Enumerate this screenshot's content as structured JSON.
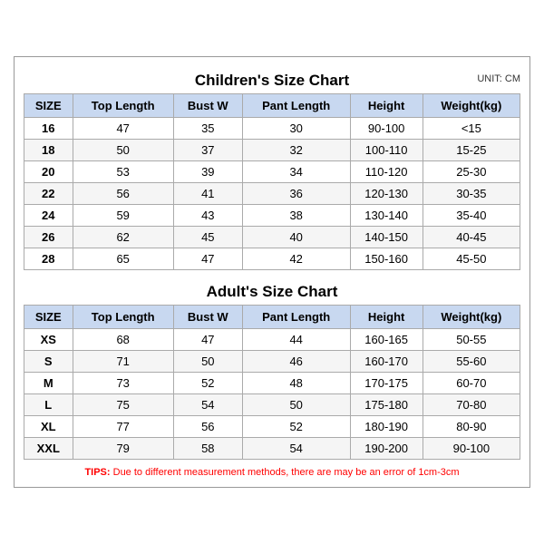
{
  "children": {
    "title": "Children's Size Chart",
    "unit": "UNIT: CM",
    "headers": [
      "SIZE",
      "Top Length",
      "Bust W",
      "Pant Length",
      "Height",
      "Weight(kg)"
    ],
    "rows": [
      [
        "16",
        "47",
        "35",
        "30",
        "90-100",
        "<15"
      ],
      [
        "18",
        "50",
        "37",
        "32",
        "100-110",
        "15-25"
      ],
      [
        "20",
        "53",
        "39",
        "34",
        "110-120",
        "25-30"
      ],
      [
        "22",
        "56",
        "41",
        "36",
        "120-130",
        "30-35"
      ],
      [
        "24",
        "59",
        "43",
        "38",
        "130-140",
        "35-40"
      ],
      [
        "26",
        "62",
        "45",
        "40",
        "140-150",
        "40-45"
      ],
      [
        "28",
        "65",
        "47",
        "42",
        "150-160",
        "45-50"
      ]
    ]
  },
  "adults": {
    "title": "Adult's Size Chart",
    "headers": [
      "SIZE",
      "Top Length",
      "Bust W",
      "Pant Length",
      "Height",
      "Weight(kg)"
    ],
    "rows": [
      [
        "XS",
        "68",
        "47",
        "44",
        "160-165",
        "50-55"
      ],
      [
        "S",
        "71",
        "50",
        "46",
        "160-170",
        "55-60"
      ],
      [
        "M",
        "73",
        "52",
        "48",
        "170-175",
        "60-70"
      ],
      [
        "L",
        "75",
        "54",
        "50",
        "175-180",
        "70-80"
      ],
      [
        "XL",
        "77",
        "56",
        "52",
        "180-190",
        "80-90"
      ],
      [
        "XXL",
        "79",
        "58",
        "54",
        "190-200",
        "90-100"
      ]
    ]
  },
  "tips": {
    "label": "TIPS:",
    "text": " Due to different measurement methods, there are may be an error of 1cm-3cm"
  }
}
